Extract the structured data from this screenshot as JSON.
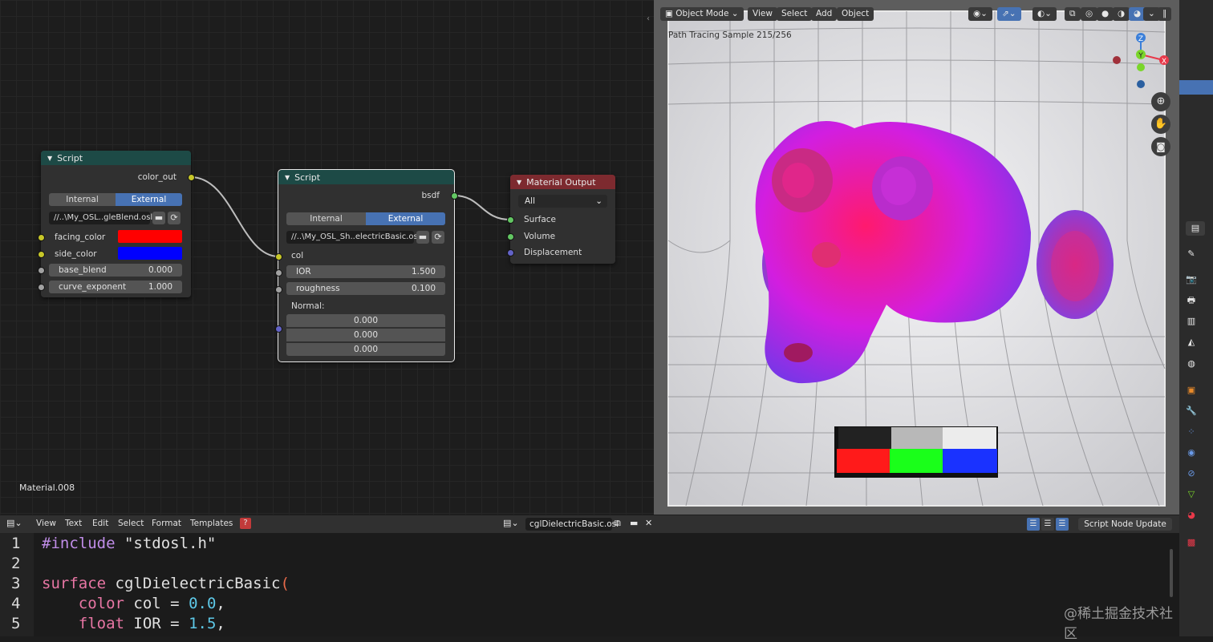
{
  "node_editor": {
    "material_name": "Material.008",
    "node1": {
      "title": "Script",
      "output": "color_out",
      "mode_internal": "Internal",
      "mode_external": "External",
      "file": "//..\\My_OSL..gleBlend.osl",
      "inputs": [
        {
          "label": "facing_color",
          "color": "#ff0000"
        },
        {
          "label": "side_color",
          "color": "#0000ff"
        }
      ],
      "fields": [
        {
          "label": "base_blend",
          "value": "0.000"
        },
        {
          "label": "curve_exponent",
          "value": "1.000"
        }
      ]
    },
    "node2": {
      "title": "Script",
      "output": "bsdf",
      "mode_internal": "Internal",
      "mode_external": "External",
      "file": "//..\\My_OSL_Sh..electricBasic.osl",
      "input_col": "col",
      "fields": [
        {
          "label": "IOR",
          "value": "1.500"
        },
        {
          "label": "roughness",
          "value": "0.100"
        }
      ],
      "normal_label": "Normal:",
      "normal_values": [
        "0.000",
        "0.000",
        "0.000"
      ]
    },
    "node3": {
      "title": "Material Output",
      "target": "All",
      "inputs": [
        "Surface",
        "Volume",
        "Displacement"
      ]
    }
  },
  "viewport": {
    "mode": "Object Mode",
    "menus": [
      "View",
      "Select",
      "Add",
      "Object"
    ],
    "status": "Path Tracing Sample 215/256",
    "gizmo": {
      "z": "Z",
      "y": "Y",
      "x": "X"
    },
    "colors": {
      "accent_red": "#e8394a",
      "axis_green": "#7ad62a",
      "axis_blue": "#3b7fd9"
    }
  },
  "text_editor": {
    "menus": [
      "View",
      "Text",
      "Edit",
      "Select",
      "Format",
      "Templates"
    ],
    "filename": "cglDielectricBasic.osl",
    "update_button": "Script Node Update",
    "line_numbers": [
      "1",
      "2",
      "3",
      "4",
      "5"
    ],
    "code": {
      "l1_pre": "#include",
      "l1_str": "\"stdosl.h\"",
      "l3_kw": "surface",
      "l3_id": "cglDielectricBasic",
      "l3_paren": "(",
      "l4_type": "color",
      "l4_id": "col =",
      "l4_num": "0.0",
      "l4_end": ",",
      "l5_type": "float",
      "l5_id": "IOR =",
      "l5_num": "1.5",
      "l5_end": ","
    }
  },
  "watermark": "@稀土掘金技术社区"
}
